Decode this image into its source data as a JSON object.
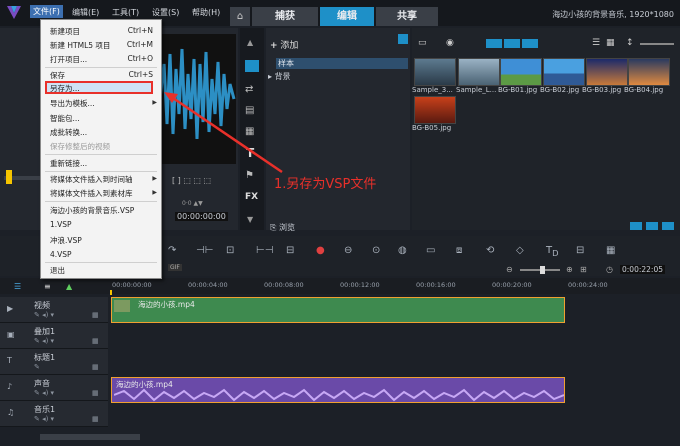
{
  "app": {
    "title": "海边小孩的背景音乐, 1920*1080",
    "menu": [
      "文件(F)",
      "编辑(E)",
      "工具(T)",
      "设置(S)",
      "帮助(H)"
    ],
    "tabs": [
      "捕获",
      "编辑",
      "共享"
    ],
    "active_tab": "编辑"
  },
  "file_menu": {
    "items": [
      {
        "label": "新建项目",
        "shortcut": "Ctrl+N"
      },
      {
        "label": "新建 HTML5 项目",
        "shortcut": "Ctrl+M"
      },
      {
        "label": "打开项目...",
        "shortcut": "Ctrl+O"
      },
      {
        "label": "保存",
        "shortcut": "Ctrl+S"
      },
      {
        "label": "另存为...",
        "shortcut": ""
      },
      {
        "label": "导出为模板...",
        "shortcut": ""
      },
      {
        "label": "智能包...",
        "shortcut": ""
      },
      {
        "label": "成批转换...",
        "shortcut": ""
      },
      {
        "label": "保存修整后的视频",
        "shortcut": ""
      },
      {
        "label": "重新链接...",
        "shortcut": ""
      },
      {
        "label": "将媒体文件插入到时间轴",
        "shortcut": ""
      },
      {
        "label": "将媒体文件插入到素材库",
        "shortcut": ""
      },
      {
        "label": "海边小孩的背景音乐.VSP",
        "shortcut": ""
      },
      {
        "label": "1.VSP",
        "shortcut": ""
      },
      {
        "label": "冲浪.VSP",
        "shortcut": ""
      },
      {
        "label": "4.VSP",
        "shortcut": ""
      },
      {
        "label": "退出",
        "shortcut": ""
      }
    ]
  },
  "annotation": {
    "text": "1.另存为VSP文件"
  },
  "library": {
    "add_label": "添加",
    "folders": [
      "样本",
      "背景"
    ],
    "browse_label": "浏览",
    "thumbnails": [
      "Sample_3...",
      "Sample_L...",
      "BG-B01.jpg",
      "BG-B02.jpg",
      "BG-B03.jpg",
      "BG-B04.jpg",
      "BG-B05.jpg"
    ]
  },
  "player": {
    "timecode": "00:00:00:00",
    "sub_timecode": "00:00:00:00"
  },
  "timeline": {
    "timecode": "0:00:22:05",
    "ruler": [
      "00:00:00:00",
      "00:00:04:00",
      "00:00:08:00",
      "00:00:12:00",
      "00:00:16:00",
      "00:00:20:00",
      "00:00:24:00"
    ],
    "tracks": [
      "视频",
      "叠加1",
      "标题1",
      "声音",
      "音乐1"
    ],
    "video_clip": "海边的小孩.mp4",
    "audio_clip": "海边的小孩.mp4"
  },
  "colors": {
    "accent": "#1e90c8",
    "annotation": "#e8302a",
    "video_clip": "#3e8a4f",
    "audio_clip": "#8a63c8"
  }
}
